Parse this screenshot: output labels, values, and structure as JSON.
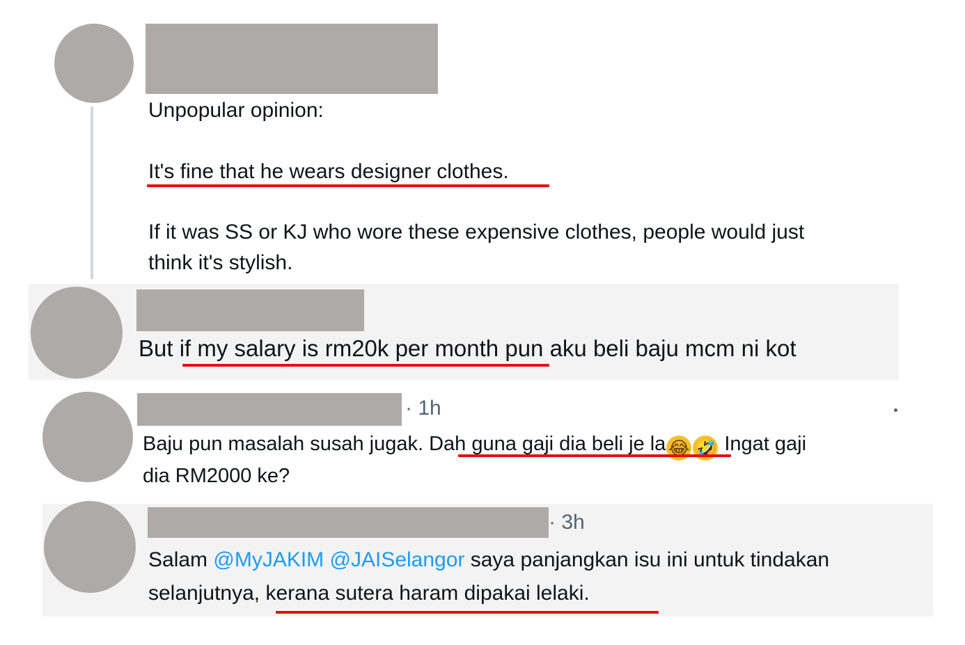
{
  "tweets": [
    {
      "lines": [
        "Unpopular opinion:",
        "It's fine that he wears designer clothes.",
        "If it was SS or KJ who wore these expensive clothes, people would just",
        "think it's stylish."
      ]
    },
    {
      "prefix": "But ",
      "highlight": "if my salary is rm20k per month",
      "suffix": " pun aku beli baju mcm ni kot"
    },
    {
      "time": "· 1h",
      "line1_prefix": "Baju pun masalah susah jugak. ",
      "line1_highlight": "Dah guna gaji dia beli je la",
      "emoji1": "😂",
      "emoji2": "🤣",
      "line1_suffix": " Ingat gaji",
      "line2": "dia RM2000 ke?"
    },
    {
      "time": "· 3h",
      "line1_prefix": "Salam ",
      "mention1": "@MyJAKIM",
      "mention2": "@JAISelangor",
      "line1_suffix": " saya panjangkan isu ini untuk tindakan",
      "line2_prefix": "selanjutnya",
      "line2_highlight": ", kerana sutera haram dipakai lelaki."
    }
  ],
  "colors": {
    "redaction": "#aeaaa9",
    "underline": "#e41010",
    "mention": "#1d9bf0",
    "panel": "#f3f3f3"
  }
}
